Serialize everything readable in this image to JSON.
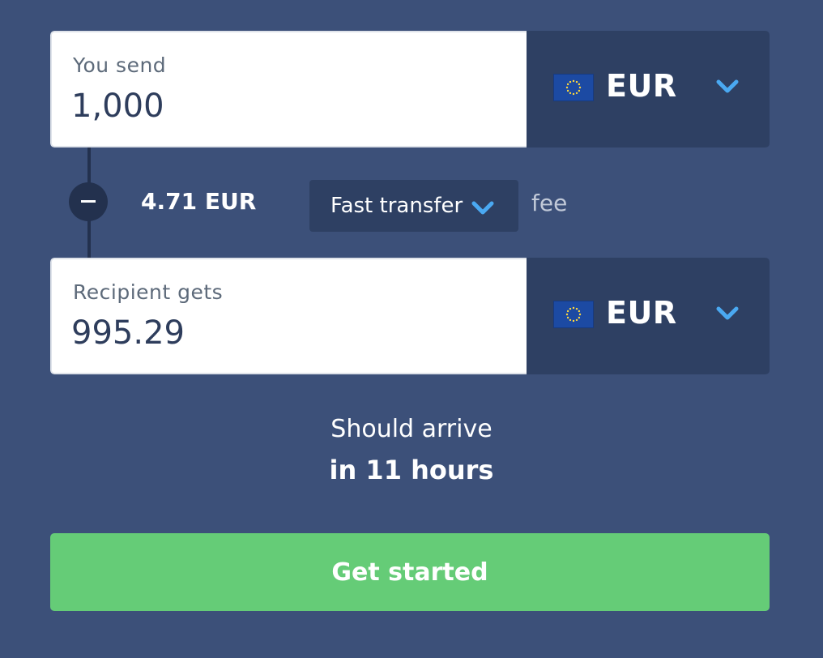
{
  "send": {
    "label": "You send",
    "amount": "1,000",
    "currency": "EUR",
    "flag_icon": "eu-flag-icon"
  },
  "fee": {
    "amount": "4.71 EUR",
    "transfer_type": "Fast transfer",
    "suffix": "fee",
    "operator_icon": "minus-icon"
  },
  "receive": {
    "label": "Recipient gets",
    "amount": "995.29",
    "currency": "EUR",
    "flag_icon": "eu-flag-icon"
  },
  "arrival": {
    "line1": "Should arrive",
    "line2": "in 11 hours"
  },
  "cta": {
    "label": "Get started"
  },
  "colors": {
    "background": "#3c5079",
    "panel": "#2e4063",
    "accent_chevron": "#4aa9f2",
    "cta": "#65cc77",
    "amount_text": "#2e3d5c"
  }
}
